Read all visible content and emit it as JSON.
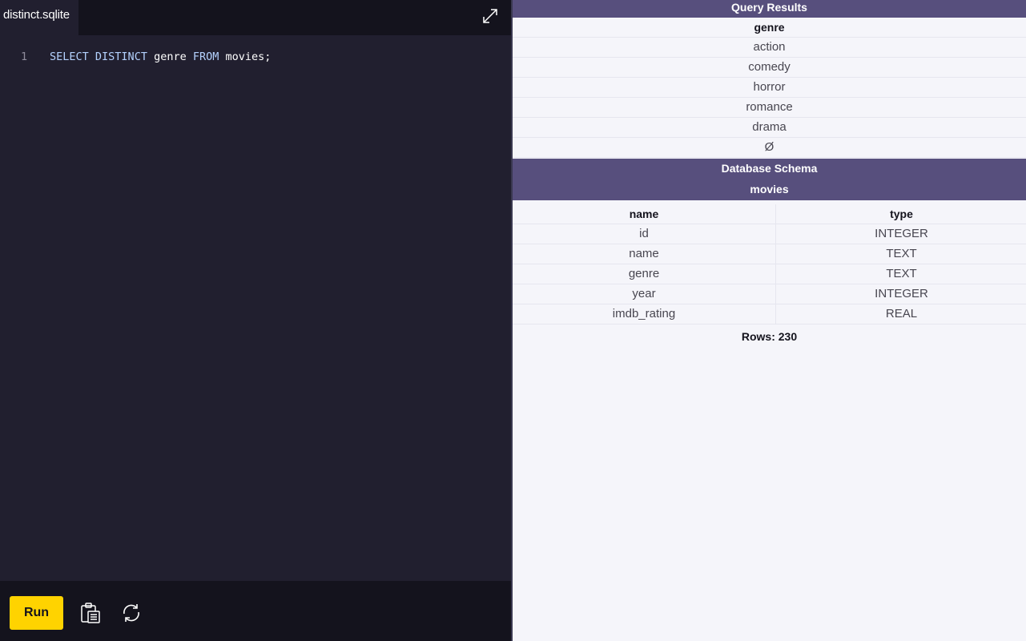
{
  "editor": {
    "tab_label": "distinct.sqlite",
    "code_lines": [
      {
        "number": "1",
        "tokens": [
          {
            "text": "SELECT",
            "kind": "kw"
          },
          {
            "text": " ",
            "kind": "ws"
          },
          {
            "text": "DISTINCT",
            "kind": "kw"
          },
          {
            "text": " ",
            "kind": "ws"
          },
          {
            "text": "genre",
            "kind": "ident"
          },
          {
            "text": " ",
            "kind": "ws"
          },
          {
            "text": "FROM",
            "kind": "kw"
          },
          {
            "text": " ",
            "kind": "ws"
          },
          {
            "text": "movies;",
            "kind": "ident"
          }
        ]
      }
    ],
    "run_label": "Run",
    "icons": {
      "expand": "expand-icon",
      "copy": "clipboard-icon",
      "reset": "refresh-icon"
    }
  },
  "results": {
    "title": "Query Results",
    "columns": [
      "genre"
    ],
    "rows": [
      "action",
      "comedy",
      "horror",
      "romance",
      "drama",
      "Ø"
    ]
  },
  "schema": {
    "title": "Database Schema",
    "table_name": "movies",
    "columns": [
      "name",
      "type"
    ],
    "rows": [
      [
        "id",
        "INTEGER"
      ],
      [
        "name",
        "TEXT"
      ],
      [
        "genre",
        "TEXT"
      ],
      [
        "year",
        "INTEGER"
      ],
      [
        "imdb_rating",
        "REAL"
      ]
    ],
    "rows_label": "Rows: 230"
  },
  "colors": {
    "accent": "#574f7d",
    "run_button": "#ffd300",
    "editor_bg": "#211f2f",
    "keyword": "#b4d2ff"
  }
}
